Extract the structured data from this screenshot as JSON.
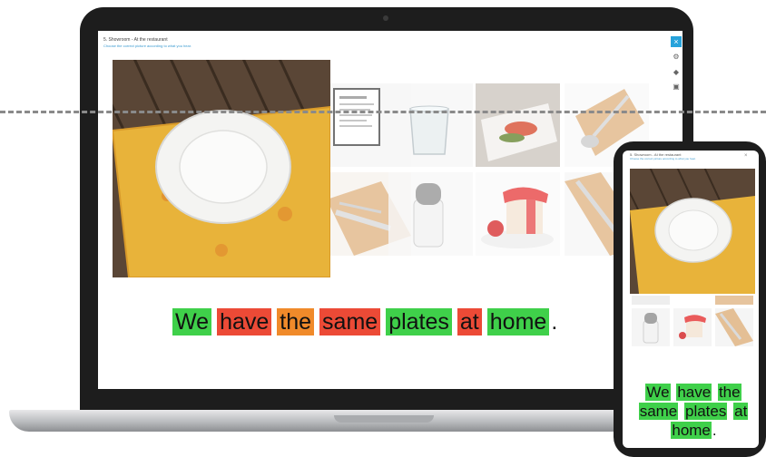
{
  "app": {
    "title": "5. Showroom - At the restaurant",
    "subtitle": "Choose the correct picture according to what you hear."
  },
  "side_buttons": {
    "close": "×",
    "b1": "⚙",
    "b2": "◆",
    "b3": "▣"
  },
  "sentence": {
    "words": [
      {
        "text": "We",
        "status": "correct"
      },
      {
        "text": "have",
        "status": "wrong"
      },
      {
        "text": "the",
        "status": "partial"
      },
      {
        "text": "same",
        "status": "wrong"
      },
      {
        "text": "plates",
        "status": "correct"
      },
      {
        "text": "at",
        "status": "wrong"
      },
      {
        "text": "home",
        "status": "correct"
      }
    ],
    "period": "."
  },
  "phone": {
    "title": "5. Showroom - At the restaurant",
    "subtitle": "Choose the correct picture according to what you hear.",
    "close": "×",
    "words": [
      {
        "text": "We",
        "status": "correct"
      },
      {
        "text": "have",
        "status": "correct"
      },
      {
        "text": "the",
        "status": "correct"
      },
      {
        "text": "same",
        "status": "correct"
      },
      {
        "text": "plates",
        "status": "correct"
      },
      {
        "text": "at",
        "status": "correct"
      },
      {
        "text": "home",
        "status": "correct"
      }
    ],
    "period": "."
  },
  "colors": {
    "correct": "#3fd04a",
    "wrong": "#ec4a36",
    "partial": "#f08a2a",
    "accent": "#27a3db"
  },
  "thumbnails": [
    {
      "name": "menu-card"
    },
    {
      "name": "water-glass"
    },
    {
      "name": "salmon-dish"
    },
    {
      "name": "spoon-on-napkin"
    },
    {
      "name": "knife-fork-napkin"
    },
    {
      "name": "salt-shaker"
    },
    {
      "name": "strawberry-dessert"
    },
    {
      "name": "cutlery-napkin"
    }
  ]
}
